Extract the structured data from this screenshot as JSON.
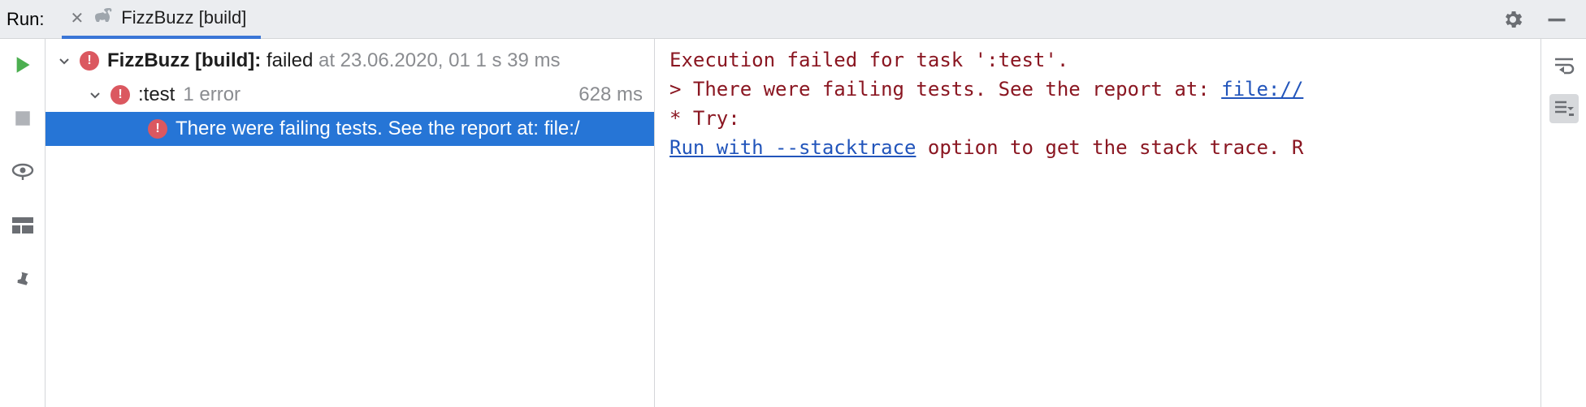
{
  "header": {
    "label": "Run:",
    "tab_label": "FizzBuzz [build]"
  },
  "tree": {
    "root": {
      "name_bold": "FizzBuzz [build]:",
      "status": "failed",
      "meta": "at 23.06.2020, 01 1 s 39 ms"
    },
    "child1": {
      "name": ":test",
      "errors": "1 error",
      "time": "628 ms"
    },
    "child2": {
      "text": "There were failing tests. See the report at: file:/"
    }
  },
  "console": {
    "line1": "Execution failed for task ':test'.",
    "line2_prefix": "> There were failing tests. See the report at: ",
    "line2_link": "file://",
    "line3": "",
    "line4": "* Try:",
    "line5_link": "Run with --stacktrace",
    "line5_suffix": " option to get the stack trace. R"
  }
}
